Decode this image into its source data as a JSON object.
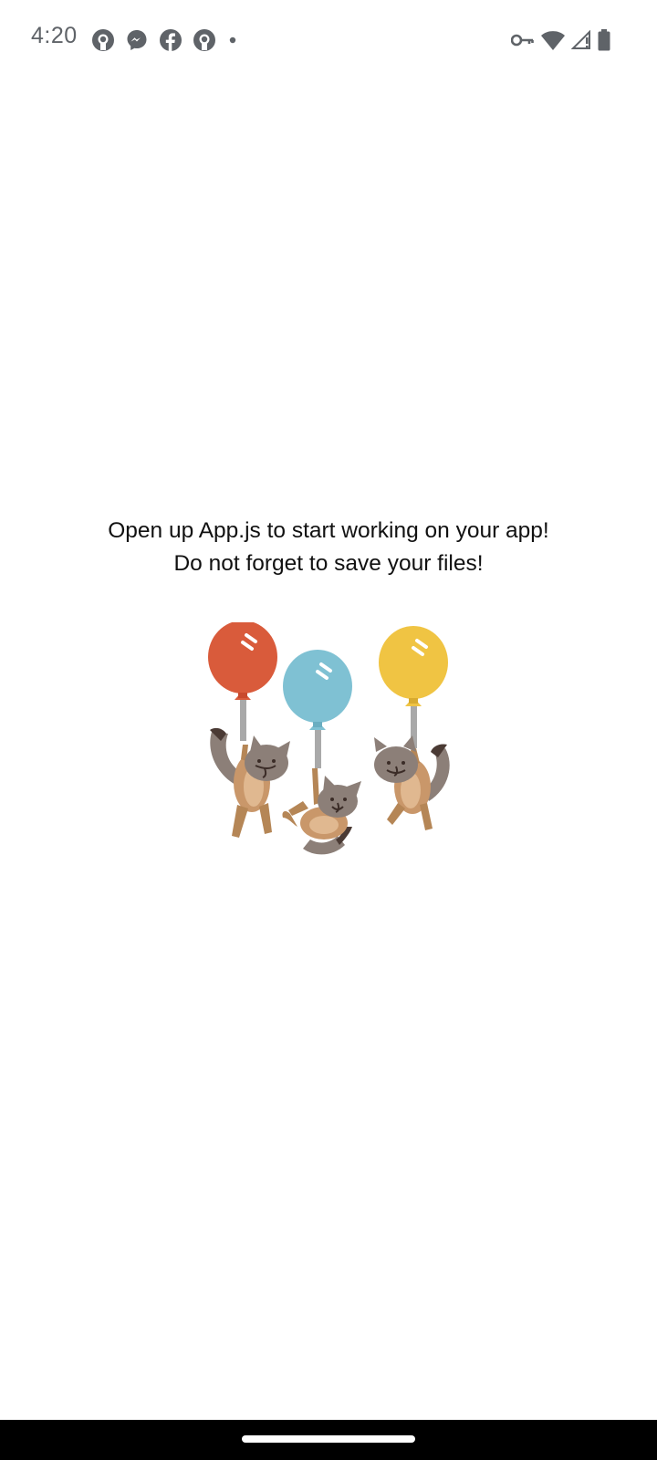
{
  "status_bar": {
    "time": "4:20",
    "notification_icons": [
      "github-icon",
      "messenger-icon",
      "facebook-icon",
      "github-icon",
      "more-notifications-dot-icon"
    ],
    "system_icons": [
      "vpn-key-icon",
      "wifi-icon",
      "cell-signal-icon",
      "battery-icon"
    ]
  },
  "main": {
    "message_line1": "Open up App.js to start working on your app!",
    "message_line2": "Do not forget to save your files!",
    "illustration": {
      "description": "three foxes holding balloons",
      "balloon_colors": [
        "#d95b3b",
        "#7fc1d3",
        "#f0c443"
      ]
    }
  },
  "nav_bar": {
    "handle": "home-gesture-handle"
  },
  "colors": {
    "background": "#ffffff",
    "status_text": "#5f6368",
    "nav_bar": "#000000"
  }
}
